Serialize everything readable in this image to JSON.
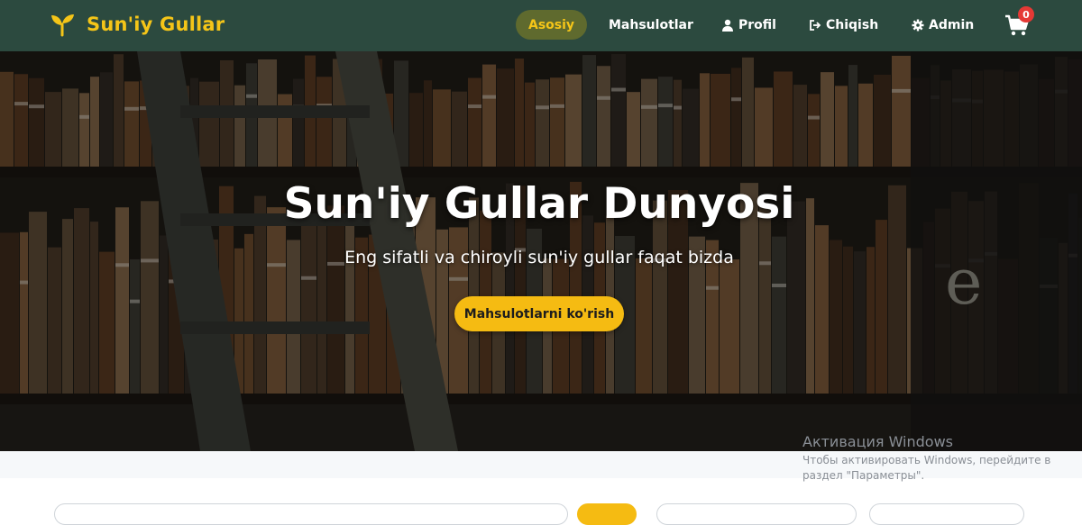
{
  "brand": {
    "name": "Sun'iy Gullar",
    "icon": "sprout-icon",
    "color": "#f5c518"
  },
  "nav": {
    "home": "Asosiy",
    "products": "Mahsulotlar",
    "profile": "Profil",
    "logout": "Chiqish",
    "admin": "Admin"
  },
  "cart": {
    "icon": "cart-icon",
    "count": "0"
  },
  "hero": {
    "title": "Sun'iy Gullar Dunyosi",
    "subtitle": "Eng sifatli va chiroyli sun'iy gullar faqat bizda",
    "button": "Mahsulotlarni ko'rish"
  },
  "watermark": {
    "title": "Активация Windows",
    "text": "Чтобы активировать Windows, перейдите в раздел \"Параметры\"."
  },
  "colors": {
    "navbar": "#2c4a3f",
    "accent": "#f5bb12",
    "badge": "#e53935"
  }
}
